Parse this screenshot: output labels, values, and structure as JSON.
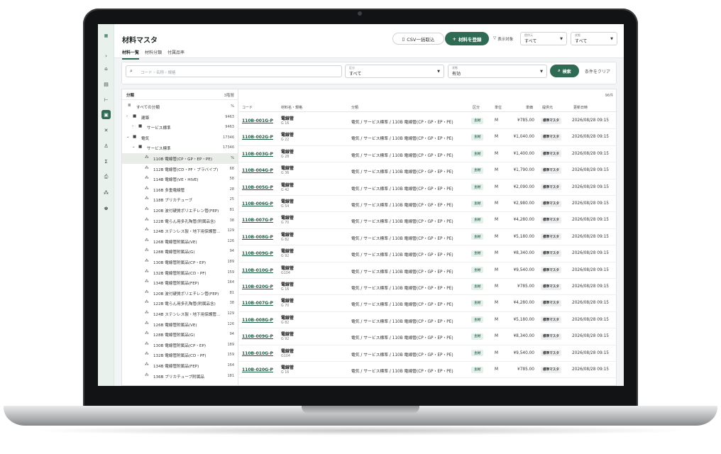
{
  "app": {
    "title": "材料マスタ",
    "tabs": [
      "材料一覧",
      "材料分類",
      "付属品率"
    ],
    "csv_button": "CSV一括取込",
    "add_button": "材料を登録",
    "display_target_label": "表示対象",
    "selects": [
      {
        "caption": "提供元",
        "value": "すべて"
      },
      {
        "caption": "状態",
        "value": "すべて"
      }
    ]
  },
  "rail": {
    "icons": [
      "logo-icon",
      "chevron-right-icon",
      "home-icon",
      "document-icon",
      "flow-icon",
      "materials-icon",
      "tools-icon",
      "users-icon",
      "sigma-icon",
      "printer-icon",
      "team-icon",
      "org-icon"
    ]
  },
  "filter": {
    "search_placeholder": "コード・名称・規格",
    "category": {
      "caption": "区分",
      "value": "すべて"
    },
    "status": {
      "caption": "状態",
      "value": "有効"
    },
    "search_button": "検索",
    "clear_button": "条件をクリア"
  },
  "tree": {
    "title": "分類",
    "level_count": "3階層",
    "nodes": [
      {
        "label": "すべての分類",
        "count": "%"
      },
      {
        "label": "建築",
        "count": "9463"
      },
      {
        "label": "サービス標準",
        "count": "9463"
      },
      {
        "label": "電気",
        "count": "17346"
      },
      {
        "label": "サービス標準",
        "count": "17346"
      },
      {
        "label": "110B 電線管(CP・GP・EP・PE)",
        "count": "%"
      },
      {
        "label": "112B 電線管(CD・PF・プラバイプ)",
        "count": "68"
      },
      {
        "label": "114B 電線管(VE・HIVE)",
        "count": "58"
      },
      {
        "label": "116B 多重電線管",
        "count": "28"
      },
      {
        "label": "118B プリカチューブ",
        "count": "25"
      },
      {
        "label": "120B 波付硬質ポリエチレン管(FEP)",
        "count": "81"
      },
      {
        "label": "122B 電らん用多孔陶管(附属品含)",
        "count": "38"
      },
      {
        "label": "124B ステンレス製・地下用保護管…",
        "count": "129"
      },
      {
        "label": "126B 電線管附属品(VE)",
        "count": "126"
      },
      {
        "label": "128B 電線管附属品(G)",
        "count": "94"
      },
      {
        "label": "130B 電線管附属品(CP・EP)",
        "count": "189"
      },
      {
        "label": "132B 電線管附属品(CD・PF)",
        "count": "159"
      },
      {
        "label": "134B 電線管附属品(FEP)",
        "count": "164"
      },
      {
        "label": "120B 波付硬質ポリエチレン管(FEP)",
        "count": "81"
      },
      {
        "label": "122B 電らん用多孔陶管(附属品含)",
        "count": "38"
      },
      {
        "label": "124B ステンレス製・地下用保護管…",
        "count": "129"
      },
      {
        "label": "126B 電線管附属品(VE)",
        "count": "126"
      },
      {
        "label": "128B 電線管附属品(G)",
        "count": "94"
      },
      {
        "label": "130B 電線管附属品(CP・EP)",
        "count": "189"
      },
      {
        "label": "132B 電線管附属品(CD・PF)",
        "count": "159"
      },
      {
        "label": "134B 電線管附属品(FEP)",
        "count": "164"
      },
      {
        "label": "136B プリカチューブ附属品",
        "count": "181"
      }
    ]
  },
  "grid": {
    "count": "96件",
    "columns": [
      "コード",
      "材料名・規格",
      "分類",
      "区分",
      "単位",
      "単価",
      "提供元",
      "更新日時"
    ],
    "rows": [
      {
        "code": "110B-001G-P",
        "name": "電線管",
        "spec": "G 16",
        "category": "電気 / サービス標準 / 110B 電線管(CP・GP・EP・PE)",
        "kubun": "主材",
        "unit": "M",
        "price": "¥785.00",
        "provider": "標準マスタ",
        "updated": "2026/08/28 09:15"
      },
      {
        "code": "110B-002G-P",
        "name": "電線管",
        "spec": "G 22",
        "category": "電気 / サービス標準 / 110B 電線管(CP・GP・EP・PE)",
        "kubun": "主材",
        "unit": "M",
        "price": "¥1,040.00",
        "provider": "標準マスタ",
        "updated": "2026/08/28 09:15"
      },
      {
        "code": "110B-003G-P",
        "name": "電線管",
        "spec": "G 28",
        "category": "電気 / サービス標準 / 110B 電線管(CP・GP・EP・PE)",
        "kubun": "主材",
        "unit": "M",
        "price": "¥1,400.00",
        "provider": "標準マスタ",
        "updated": "2026/08/28 09:15"
      },
      {
        "code": "110B-004G-P",
        "name": "電線管",
        "spec": "G 36",
        "category": "電気 / サービス標準 / 110B 電線管(CP・GP・EP・PE)",
        "kubun": "主材",
        "unit": "M",
        "price": "¥1,790.00",
        "provider": "標準マスタ",
        "updated": "2026/08/28 09:15"
      },
      {
        "code": "110B-005G-P",
        "name": "電線管",
        "spec": "G 42",
        "category": "電気 / サービス標準 / 110B 電線管(CP・GP・EP・PE)",
        "kubun": "主材",
        "unit": "M",
        "price": "¥2,090.00",
        "provider": "標準マスタ",
        "updated": "2026/08/28 09:15"
      },
      {
        "code": "110B-006G-P",
        "name": "電線管",
        "spec": "G 54",
        "category": "電気 / サービス標準 / 110B 電線管(CP・GP・EP・PE)",
        "kubun": "主材",
        "unit": "M",
        "price": "¥2,980.00",
        "provider": "標準マスタ",
        "updated": "2026/08/28 09:15"
      },
      {
        "code": "110B-007G-P",
        "name": "電線管",
        "spec": "G 70",
        "category": "電気 / サービス標準 / 110B 電線管(CP・GP・EP・PE)",
        "kubun": "主材",
        "unit": "M",
        "price": "¥4,280.00",
        "provider": "標準マスタ",
        "updated": "2026/08/28 09:15"
      },
      {
        "code": "110B-008G-P",
        "name": "電線管",
        "spec": "G 82",
        "category": "電気 / サービス標準 / 110B 電線管(CP・GP・EP・PE)",
        "kubun": "主材",
        "unit": "M",
        "price": "¥5,180.00",
        "provider": "標準マスタ",
        "updated": "2026/08/28 09:15"
      },
      {
        "code": "110B-009G-P",
        "name": "電線管",
        "spec": "G 92",
        "category": "電気 / サービス標準 / 110B 電線管(CP・GP・EP・PE)",
        "kubun": "主材",
        "unit": "M",
        "price": "¥8,340.00",
        "provider": "標準マスタ",
        "updated": "2026/08/28 09:15"
      },
      {
        "code": "110B-010G-P",
        "name": "電線管",
        "spec": "G104",
        "category": "電気 / サービス標準 / 110B 電線管(CP・GP・EP・PE)",
        "kubun": "主材",
        "unit": "M",
        "price": "¥9,540.00",
        "provider": "標準マスタ",
        "updated": "2026/08/28 09:15"
      },
      {
        "code": "110B-020G-P",
        "name": "電線管",
        "spec": "G 16",
        "category": "電気 / サービス標準 / 110B 電線管(CP・GP・EP・PE)",
        "kubun": "主材",
        "unit": "M",
        "price": "¥785.00",
        "provider": "標準マスタ",
        "updated": "2026/08/28 09:15"
      },
      {
        "code": "110B-007G-P",
        "name": "電線管",
        "spec": "G 70",
        "category": "電気 / サービス標準 / 110B 電線管(CP・GP・EP・PE)",
        "kubun": "主材",
        "unit": "M",
        "price": "¥4,280.00",
        "provider": "標準マスタ",
        "updated": "2026/08/28 09:15"
      },
      {
        "code": "110B-008G-P",
        "name": "電線管",
        "spec": "G 82",
        "category": "電気 / サービス標準 / 110B 電線管(CP・GP・EP・PE)",
        "kubun": "主材",
        "unit": "M",
        "price": "¥5,180.00",
        "provider": "標準マスタ",
        "updated": "2026/08/28 09:15"
      },
      {
        "code": "110B-009G-P",
        "name": "電線管",
        "spec": "G 92",
        "category": "電気 / サービス標準 / 110B 電線管(CP・GP・EP・PE)",
        "kubun": "主材",
        "unit": "M",
        "price": "¥8,340.00",
        "provider": "標準マスタ",
        "updated": "2026/08/28 09:15"
      },
      {
        "code": "110B-010G-P",
        "name": "電線管",
        "spec": "G104",
        "category": "電気 / サービス標準 / 110B 電線管(CP・GP・EP・PE)",
        "kubun": "主材",
        "unit": "M",
        "price": "¥9,540.00",
        "provider": "標準マスタ",
        "updated": "2026/08/28 09:15"
      },
      {
        "code": "110B-020G-P",
        "name": "電線管",
        "spec": "G 16",
        "category": "電気 / サービス標準 / 110B 電線管(CP・GP・EP・PE)",
        "kubun": "主材",
        "unit": "M",
        "price": "¥785.00",
        "provider": "標準マスタ",
        "updated": "2026/08/28 09:15"
      }
    ]
  },
  "colors": {
    "accent": "#2f6b53",
    "rail_bg": "#e8f1ec",
    "laptop_frame": "#121314"
  }
}
